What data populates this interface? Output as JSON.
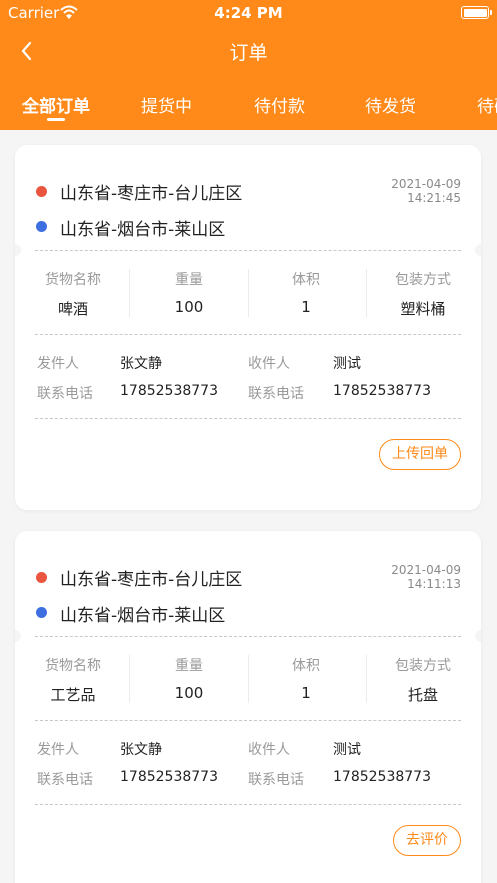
{
  "status_bar": {
    "carrier": "Carrier",
    "time": "4:24 PM"
  },
  "nav": {
    "title": "订单"
  },
  "tabs": [
    {
      "label": "全部订单",
      "active": true
    },
    {
      "label": "提货中",
      "active": false
    },
    {
      "label": "待付款",
      "active": false
    },
    {
      "label": "待发货",
      "active": false
    },
    {
      "label": "待确",
      "active": false
    }
  ],
  "colors": {
    "brand": "#ff8a1a",
    "origin_dot": "#e9553f",
    "destination_dot": "#3e6fe0"
  },
  "columns": [
    "货物名称",
    "重量",
    "体积",
    "包装方式"
  ],
  "labels": {
    "sender": "发件人",
    "receiver": "收件人",
    "phone": "联系电话"
  },
  "orders": [
    {
      "from": "山东省-枣庄市-台儿庄区",
      "to": "山东省-烟台市-莱山区",
      "date": "2021-04-09",
      "time": "14:21:45",
      "goods": "啤酒",
      "weight": "100",
      "volume": "1",
      "packaging": "塑料桶",
      "sender": "张文静",
      "sender_phone": "17852538773",
      "receiver": "测试",
      "receiver_phone": "17852538773",
      "action": "上传回单"
    },
    {
      "from": "山东省-枣庄市-台儿庄区",
      "to": "山东省-烟台市-莱山区",
      "date": "2021-04-09",
      "time": "14:11:13",
      "goods": "工艺品",
      "weight": "100",
      "volume": "1",
      "packaging": "托盘",
      "sender": "张文静",
      "sender_phone": "17852538773",
      "receiver": "测试",
      "receiver_phone": "17852538773",
      "action": "去评价"
    }
  ]
}
